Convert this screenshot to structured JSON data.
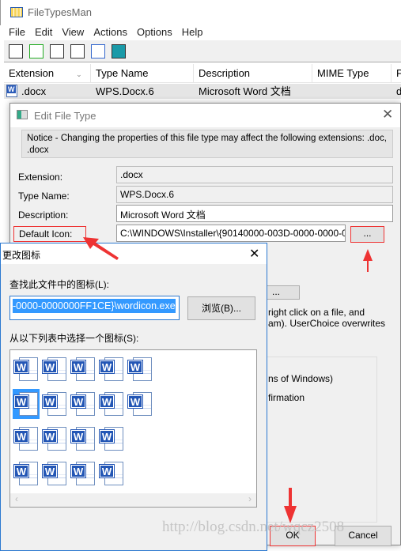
{
  "app": {
    "title": "FileTypesMan",
    "menu": [
      "File",
      "Edit",
      "View",
      "Actions",
      "Options",
      "Help"
    ],
    "toolbar": [
      "save-icon",
      "refresh-icon",
      "copy-icon",
      "properties-icon",
      "find-icon",
      "exit-icon"
    ]
  },
  "list": {
    "columns": [
      "Extension",
      "Type Name",
      "Description",
      "MIME Type",
      "P"
    ],
    "rows": [
      {
        "extension": ".docx",
        "type_name": "WPS.Docx.6",
        "description": "Microsoft Word 文档",
        "mime": "",
        "p": "d"
      }
    ]
  },
  "edit": {
    "title": "Edit File Type",
    "notice": "Notice - Changing the properties of this file type may affect the following extensions: .doc, .docx",
    "labels": {
      "extension": "Extension:",
      "type_name": "Type Name:",
      "description": "Description:",
      "default_icon": "Default Icon:"
    },
    "values": {
      "extension": ".docx",
      "type_name": "WPS.Docx.6",
      "description": "Microsoft Word 文档",
      "default_icon": "C:\\WINDOWS\\Installer\\{90140000-003D-0000-0000-0000"
    },
    "browse_label": "...",
    "browse2_label": "...",
    "partial1": "right click on a file, and",
    "partial2": "am). UserChoice overwrites",
    "partial3": "ns of Windows)",
    "partial4": "firmation",
    "ok": "OK",
    "cancel": "Cancel"
  },
  "change_icon": {
    "title": "更改图标",
    "file_label": "查找此文件中的图标(L):",
    "file_value": "-0000-0000000FF1CE}\\wordicon.exe",
    "browse": "浏览(B)...",
    "list_label": "从以下列表中选择一个图标(S):",
    "icon_count": [
      5,
      5,
      4,
      4
    ],
    "selected_index": 5
  },
  "watermark": "http://blog.csdn.net/wqcz2508",
  "colors": {
    "accent": "#3399ff",
    "annotation": "#ee3333"
  }
}
